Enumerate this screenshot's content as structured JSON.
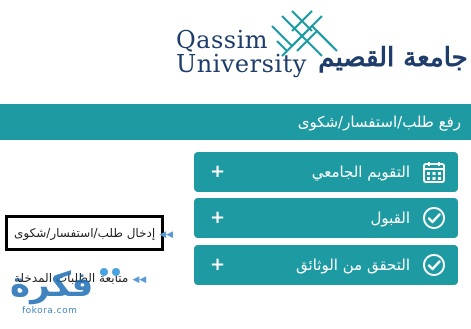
{
  "header": {
    "logo_en_line1": "Qassim",
    "logo_en_line2": "University",
    "logo_ar": "جامعة القصيم"
  },
  "page_title": "رفع طلب/استفسار/شكوى",
  "accordion": [
    {
      "label": "التقويم الجامعي",
      "icon": "calendar-icon",
      "expand": "+"
    },
    {
      "label": "القبول",
      "icon": "check-circle-icon",
      "expand": "+"
    },
    {
      "label": "التحقق من الوثائق",
      "icon": "check-circle-icon",
      "expand": "+"
    }
  ],
  "sidebar": {
    "items": [
      {
        "label": "إدخال طلب/استفسار/شكوى",
        "icon": "double-arrow-icon"
      },
      {
        "label": "متابعة الطلبات المدخلة",
        "icon": "double-arrow-icon"
      }
    ]
  },
  "watermark": {
    "text": "فكرة",
    "domain": "fokora.com"
  },
  "colors": {
    "teal": "#1e9aa2",
    "navy": "#1e3d6b",
    "watermark_blue": "#1e6fb6"
  }
}
